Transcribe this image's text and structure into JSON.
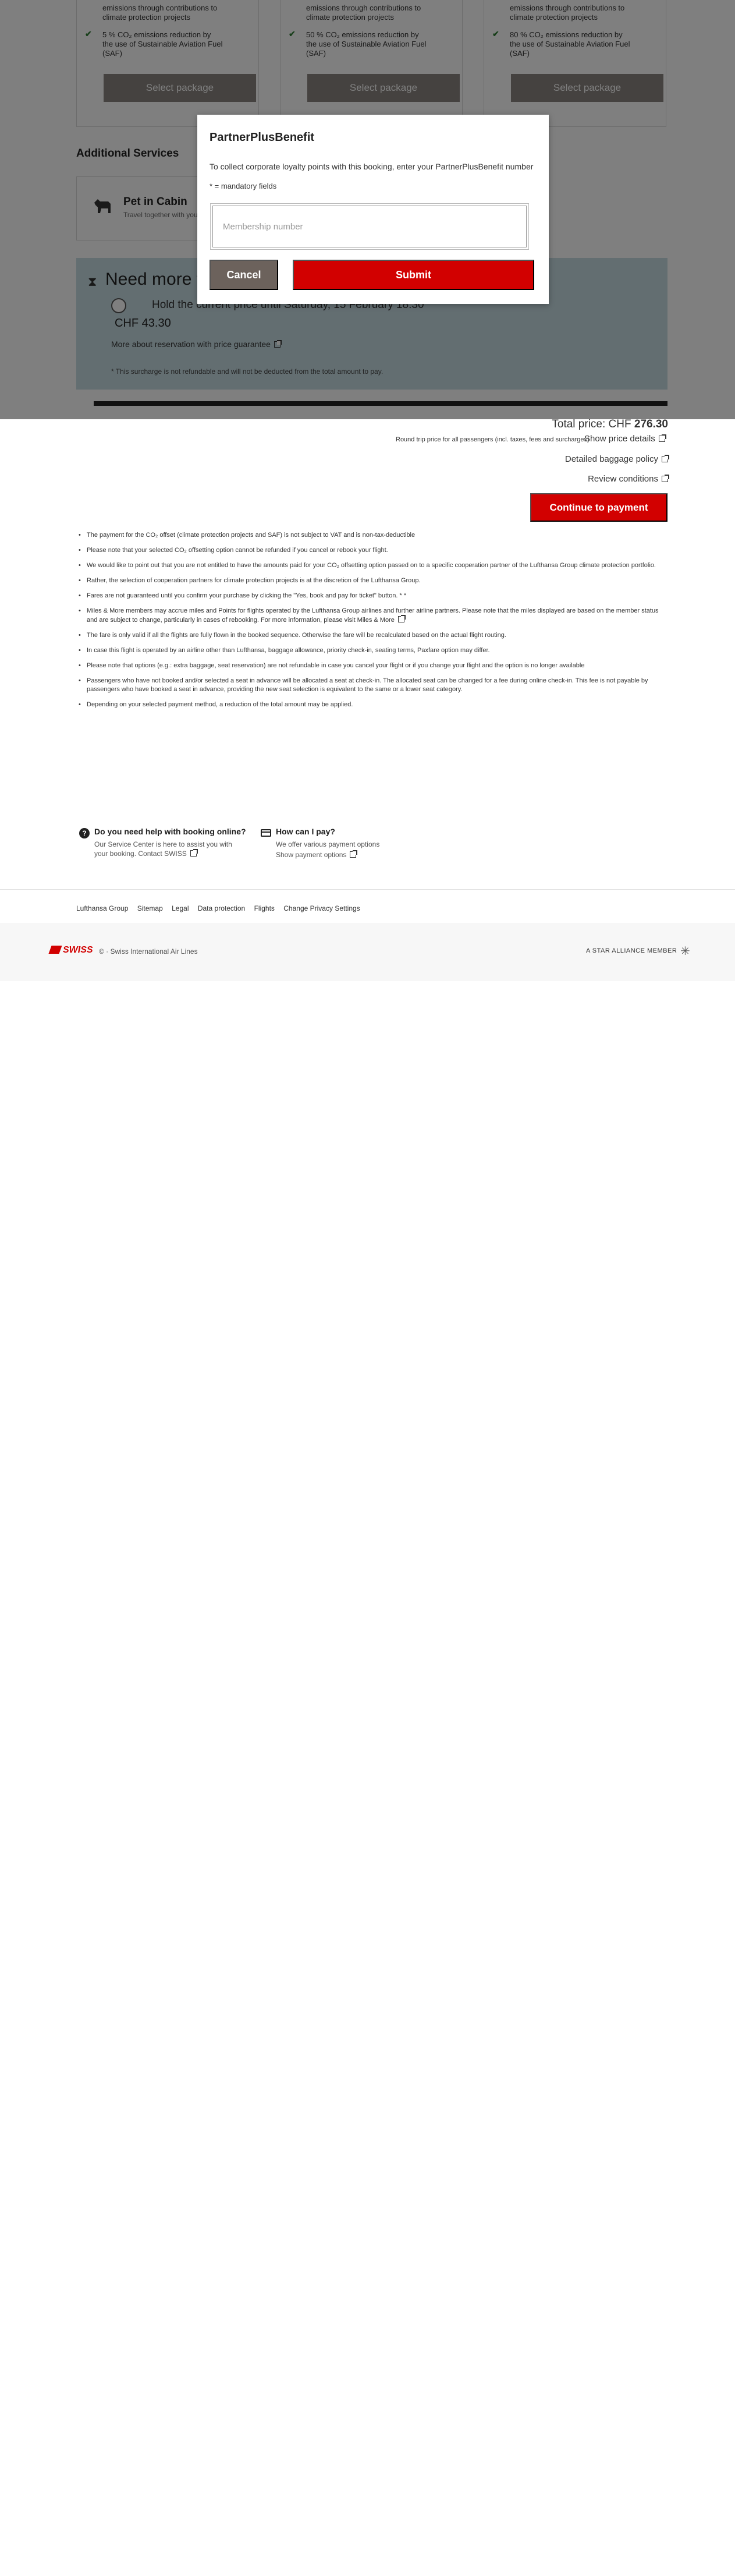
{
  "packages": [
    {
      "bullets": [
        "emissions through contributions to",
        "climate protection projects",
        "5 % CO₂ emissions reduction by",
        "the use of Sustainable Aviation Fuel",
        "(SAF)"
      ],
      "button_label": "Select package"
    },
    {
      "bullets": [
        "emissions through contributions to",
        "climate protection projects",
        "50 % CO₂ emissions reduction by",
        "the use of Sustainable Aviation Fuel",
        "(SAF)"
      ],
      "button_label": "Select package"
    },
    {
      "bullets": [
        "emissions through contributions to",
        "climate protection projects",
        "80 % CO₂ emissions reduction by",
        "the use of Sustainable Aviation Fuel",
        "(SAF)"
      ],
      "button_label": "Select package"
    }
  ],
  "additional_services": {
    "title": "Additional Services",
    "pet": {
      "title": "Pet in Cabin",
      "subtitle": "Travel together with your"
    }
  },
  "hold": {
    "title": "Need more ti",
    "option": "Hold the current price until Saturday, 15 February 18:30",
    "price": "CHF 43.30",
    "link": "More about reservation with price guarantee",
    "note": "* This surcharge is not refundable and will not be deducted from the total amount to pay."
  },
  "progress": {
    "value_percent": 3
  },
  "modal": {
    "title": "PartnerPlusBenefit",
    "description": "To collect corporate loyalty points with this booking, enter your PartnerPlusBenefit number",
    "required_note": "* = mandatory fields",
    "input_placeholder": "Membership number",
    "cancel_label": "Cancel",
    "submit_label": "Submit"
  },
  "price": {
    "total_prefix": "Total price: CHF ",
    "total_value": "276.30",
    "roundtrip_note": "Round trip price for all passengers (incl. taxes, fees and surcharges)",
    "show_details": "Show price details",
    "baggage_policy": "Detailed baggage policy",
    "review_conditions": "Review conditions",
    "continue_label": "Continue to payment"
  },
  "notes": [
    "The payment for the CO₂ offset (climate protection projects and SAF) is not subject to VAT and is non-tax-deductible",
    "Please note that your selected CO₂ offsetting option cannot be refunded if you cancel or rebook your flight.",
    "We would like to point out that you are not entitled to have the amounts paid for your CO₂ offsetting option passed on to a specific cooperation partner of the Lufthansa Group climate protection portfolio.",
    "Rather, the selection of cooperation partners for climate protection projects is at the discretion of the Lufthansa Group.",
    "Fares are not guaranteed until you confirm your purchase by clicking the \"Yes, book and pay for ticket\" button. * *",
    "Miles & More members may accrue miles and Points for flights operated by the Lufthansa Group airlines and further airline partners. Please note that the miles displayed are based on the member status and are subject to change, particularly in cases of rebooking. For more information, please visit Miles & More",
    "The fare is only valid if all the flights are fully flown in the booked sequence. Otherwise the fare will be recalculated based on the actual flight routing.",
    "In case this flight is operated by an airline other than Lufthansa, baggage allowance, priority check-in, seating terms, Paxfare option may differ.",
    "Please note that options (e.g.: extra baggage, seat reservation) are not refundable in case you cancel your flight or if you change your flight and the option is no longer available",
    "Passengers who have not booked and/or selected a seat in advance will be allocated a seat at check-in. The allocated seat can be changed for a fee during online check-in. This fee is not payable by passengers who have booked a seat in advance, providing the new seat selection is equivalent to the same or a lower seat category.",
    "Depending on your selected payment method, a reduction of the total amount may be applied."
  ],
  "help": {
    "booking": {
      "title": "Do you need help with booking online?",
      "text": "Our Service Center is here to assist you with your booking. Contact SWISS"
    },
    "payment": {
      "title": "How can I pay?",
      "text": "We offer various payment options",
      "link": "Show payment options"
    }
  },
  "footer": {
    "links": [
      "Lufthansa Group",
      "Sitemap",
      "Legal",
      "Data protection",
      "Flights",
      "Change Privacy Settings"
    ],
    "brand": "SWISS",
    "copyright": "© · Swiss International Air Lines",
    "alliance": "A STAR ALLIANCE MEMBER"
  },
  "colors": {
    "accent_red": "#d20000",
    "hold_bg": "#c7dde3",
    "cancel_bg": "#6c625c"
  }
}
